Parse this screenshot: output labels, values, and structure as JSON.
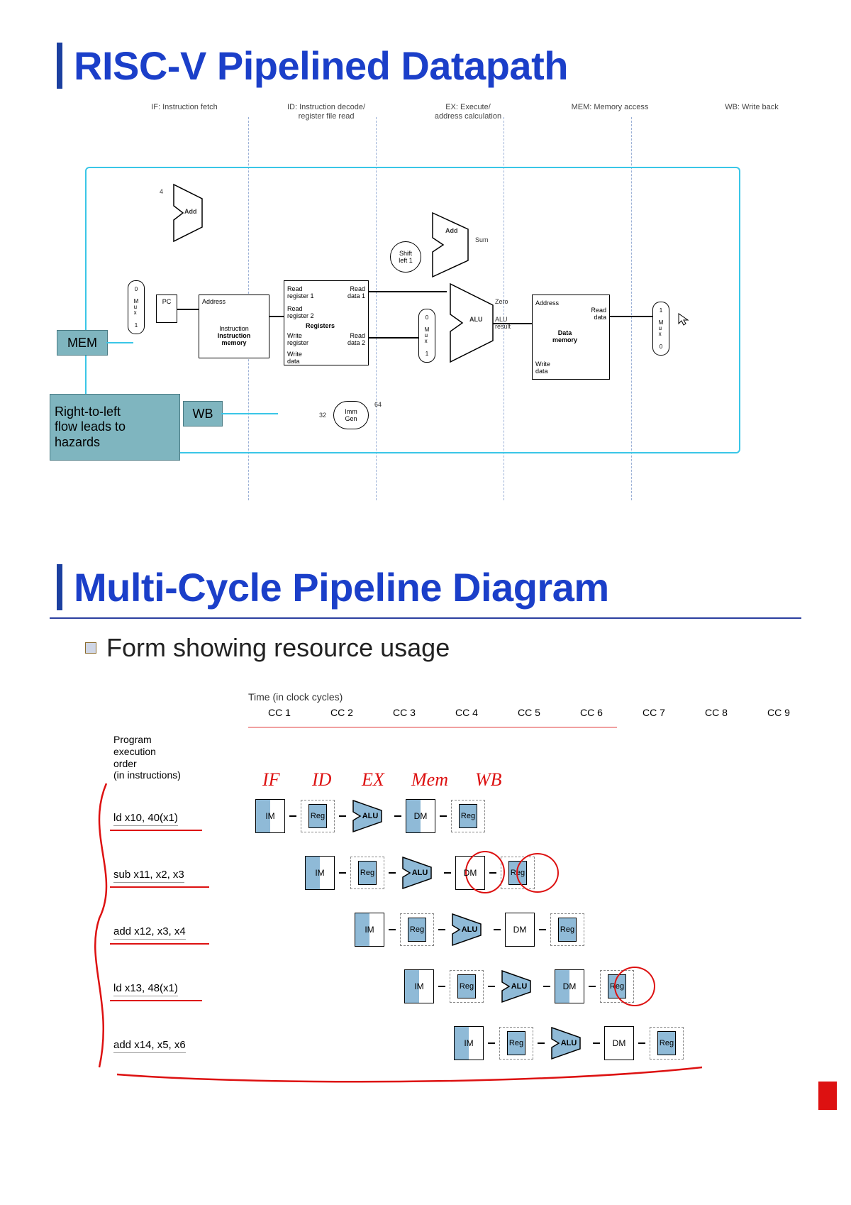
{
  "slide1": {
    "title": "RISC-V Pipelined Datapath",
    "stages": {
      "if": "IF: Instruction fetch",
      "id": "ID: Instruction decode/\nregister file read",
      "ex": "EX: Execute/\naddress calculation",
      "mem": "MEM: Memory access",
      "wb": "WB: Write back"
    },
    "blocks": {
      "pc": "PC",
      "add1": "Add",
      "add2": "Add",
      "sum": "Sum",
      "four": "4",
      "instr_mem": "Instruction\nmemory",
      "instr_mem_sub": "Instruction",
      "addr": "Address",
      "reg_read1": "Read\nregister 1",
      "reg_read2": "Read\nregister 2",
      "reg_data1": "Read\ndata 1",
      "reg_data2": "Read\ndata 2",
      "reg_write": "Write\nregister",
      "reg_writedata": "Write\ndata",
      "registers": "Registers",
      "shift": "Shift\nleft 1",
      "alu": "ALU",
      "alu_result": "ALU\nresult",
      "zero": "Zero",
      "mux0": "0",
      "muxM": "M\nu\nx",
      "mux1": "1",
      "imm_gen": "Imm\nGen",
      "imm_in": "32",
      "imm_out": "64",
      "data_addr": "Address",
      "data_read": "Read\ndata",
      "data_write": "Write\ndata",
      "data_mem": "Data\nmemory"
    },
    "notes": {
      "hazard": "Right-to-left\nflow leads to\nhazards",
      "mem_tag": "MEM",
      "wb_tag": "WB"
    }
  },
  "slide2": {
    "title": "Multi-Cycle Pipeline Diagram",
    "subtitle": "Form showing resource usage",
    "time_header": "Time (in clock cycles)",
    "cycles": [
      "CC 1",
      "CC 2",
      "CC 3",
      "CC 4",
      "CC 5",
      "CC 6",
      "CC 7",
      "CC 8",
      "CC 9"
    ],
    "program_label": "Program\nexecution\norder\n(in instructions)",
    "instructions": [
      "ld x10, 40(x1)",
      "sub x11, x2, x3",
      "add x12, x3, x4",
      "ld x13, 48(x1)",
      "add x14, x5, x6"
    ],
    "stage_boxes": {
      "im": "IM",
      "reg": "Reg",
      "alu": "ALU",
      "dm": "DM"
    },
    "handwriting": {
      "if": "IF",
      "id": "ID",
      "ex": "EX",
      "mem": "Mem",
      "wb": "WB"
    }
  }
}
